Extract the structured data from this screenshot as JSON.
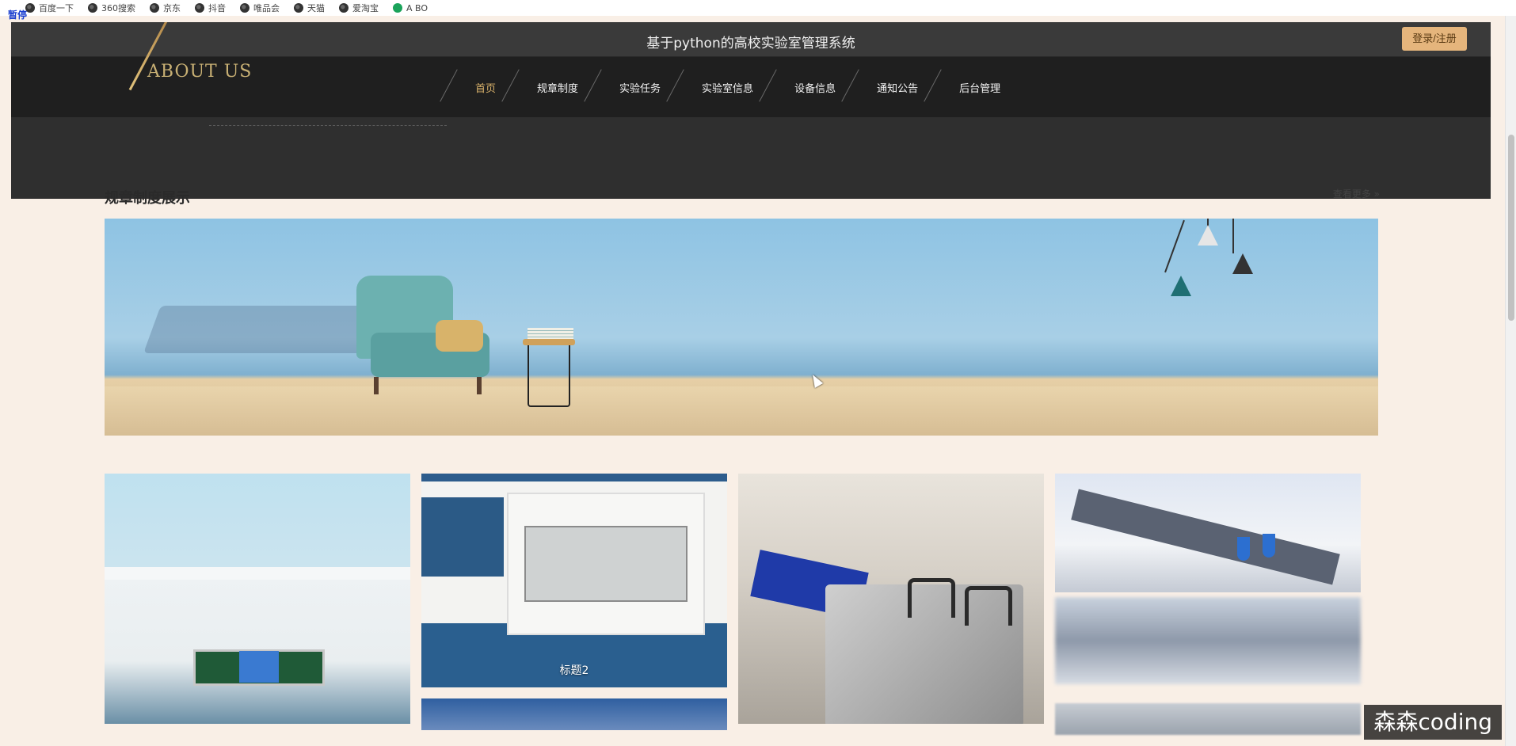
{
  "bookmarks": [
    "百度一下",
    "360搜索",
    "京东",
    "抖音",
    "唯品会",
    "天猫",
    "爱淘宝",
    "A BO"
  ],
  "pause_label": "暂停",
  "site": {
    "title": "基于python的高校实验室管理系统",
    "login_label": "登录/注册"
  },
  "banner": {
    "about_text": "ABOUT US"
  },
  "nav": {
    "items": [
      {
        "label": "首页",
        "active": true
      },
      {
        "label": "规章制度"
      },
      {
        "label": "实验任务"
      },
      {
        "label": "实验室信息"
      },
      {
        "label": "设备信息"
      },
      {
        "label": "通知公告"
      },
      {
        "label": "后台管理"
      }
    ]
  },
  "section": {
    "title": "规章制度展示",
    "more_label": "查看更多 »"
  },
  "cards": [
    {
      "caption": ""
    },
    {
      "caption": "标题2"
    },
    {
      "caption": ""
    },
    {
      "caption": ""
    }
  ],
  "watermark": "森森coding",
  "colors": {
    "topbar": "#3a3a3a",
    "navbar": "#1f1f1f",
    "accent_gold": "#d9b26b",
    "login_button": "#e5b57c",
    "page_bg": "#f9efe6"
  }
}
